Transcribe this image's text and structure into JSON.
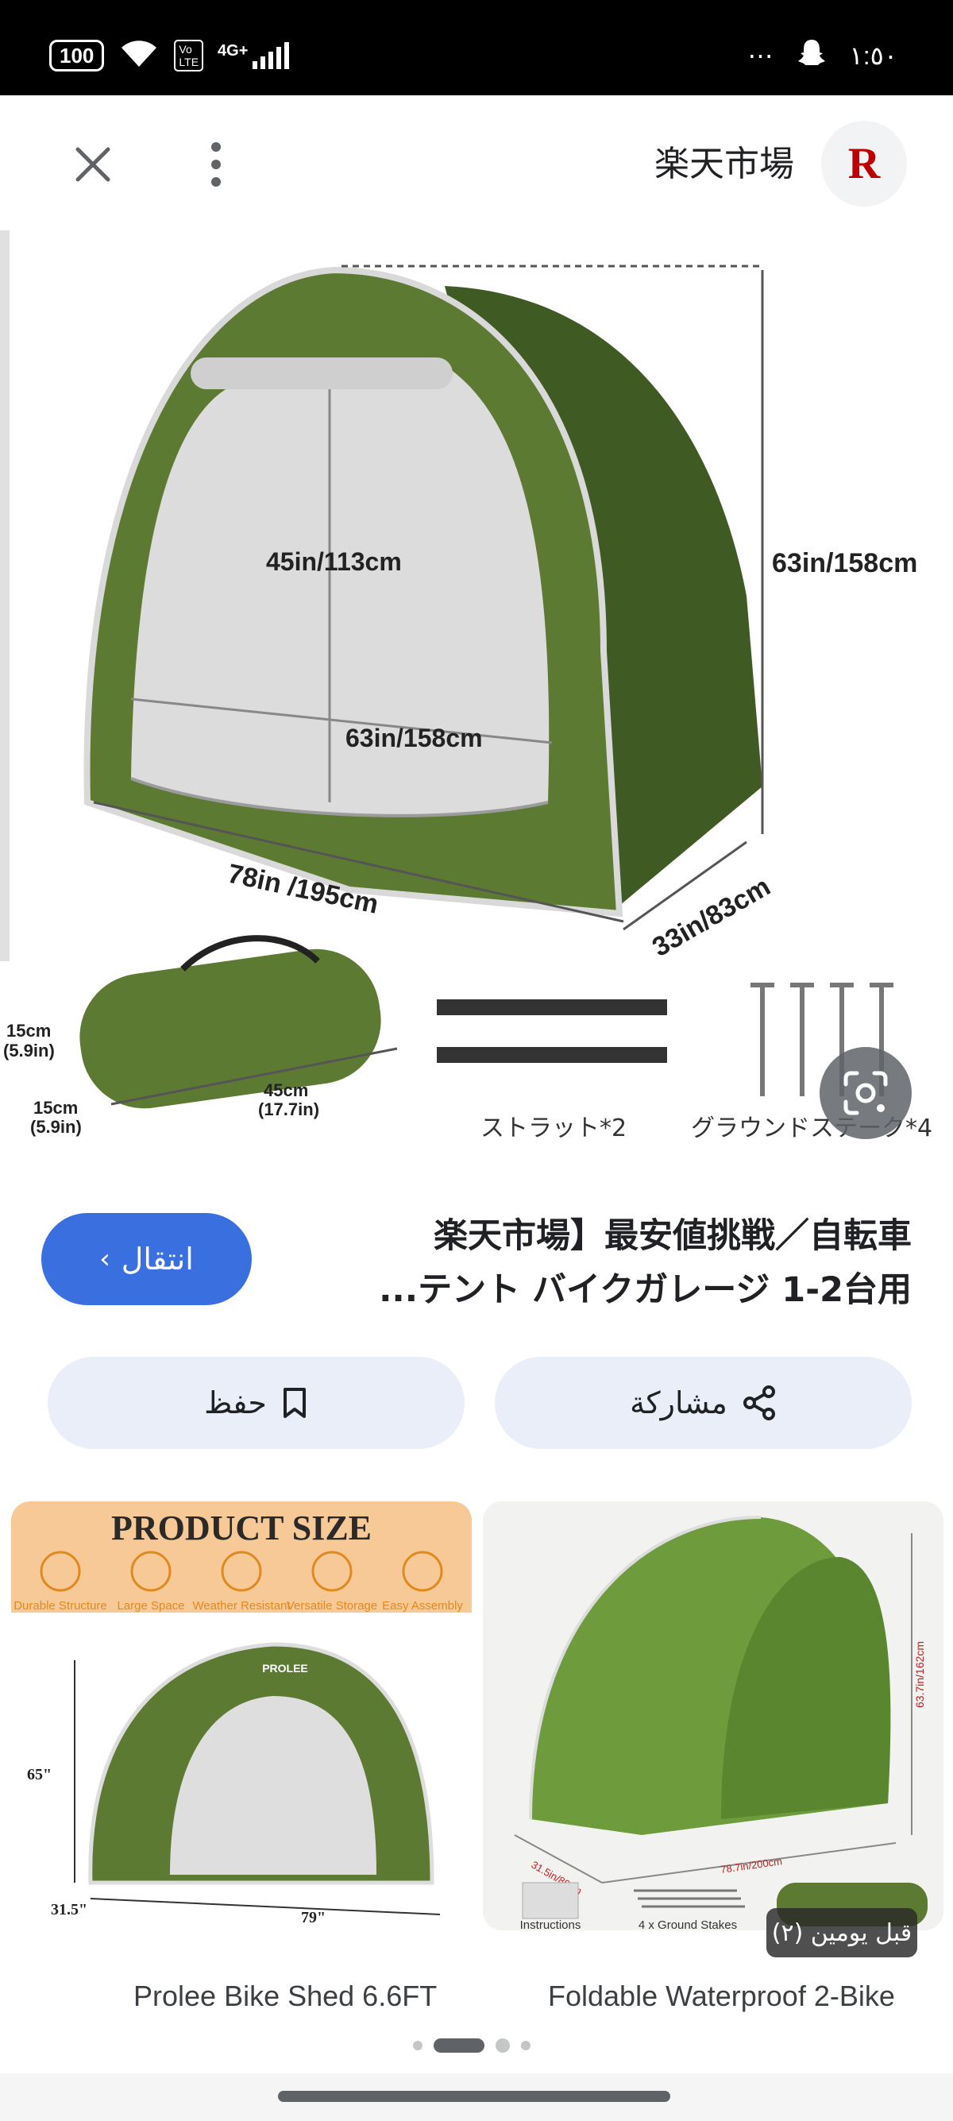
{
  "status_bar": {
    "battery": "100",
    "time": "١:٥٠",
    "network": "4G+",
    "more": "⋯"
  },
  "top_bar": {
    "site_name": "楽天市場",
    "logo_letter": "R"
  },
  "main_image": {
    "labels": {
      "height_inner": "45in/113cm",
      "width_inner": "63in/158cm",
      "height_outer": "63in/158cm",
      "length": "78in /195cm",
      "depth": "33in/83cm",
      "bag_h1": "15cm",
      "bag_h1_in": "(5.9in)",
      "bag_h2": "15cm",
      "bag_h2_in": "(5.9in)",
      "bag_len": "45cm",
      "bag_len_in": "(17.7in)",
      "strut": "ストラット*2",
      "stake": "グラウンドステーク*4"
    }
  },
  "result": {
    "title_line1": "楽天市場】最安値挑戦／自転車",
    "title_line2": "...テント バイクガレージ 1-2台用",
    "go_button": "انتقال"
  },
  "actions": {
    "save": "حفظ",
    "share": "مشاركة"
  },
  "related": [
    {
      "caption": "Prolee Bike Shed 6.6FT",
      "banner": "PRODUCT SIZE",
      "features": [
        "Durable Structure",
        "Large Space",
        "Weather Resistant",
        "Versatile Storage",
        "Easy Assembly"
      ],
      "brand": "PROLEE",
      "dim_h": "65\"",
      "dim_d": "31.5\"",
      "dim_w": "79\""
    },
    {
      "caption": "Foldable Waterproof 2-Bike",
      "dim_h": "63.7in/162cm",
      "dim_d": "31.5in/80cm",
      "dim_w": "78.7in/200cm",
      "item1": "Instructions",
      "item2": "4 x Ground Stakes",
      "time_ago": "قبل يومين (٢)"
    }
  ],
  "colors": {
    "tent_green": "#5d7a32",
    "tent_dark": "#3f5a22",
    "accent_blue": "#3a6fe0",
    "pill_bg": "#e9eef9",
    "rakuten_red": "#bf0000"
  }
}
